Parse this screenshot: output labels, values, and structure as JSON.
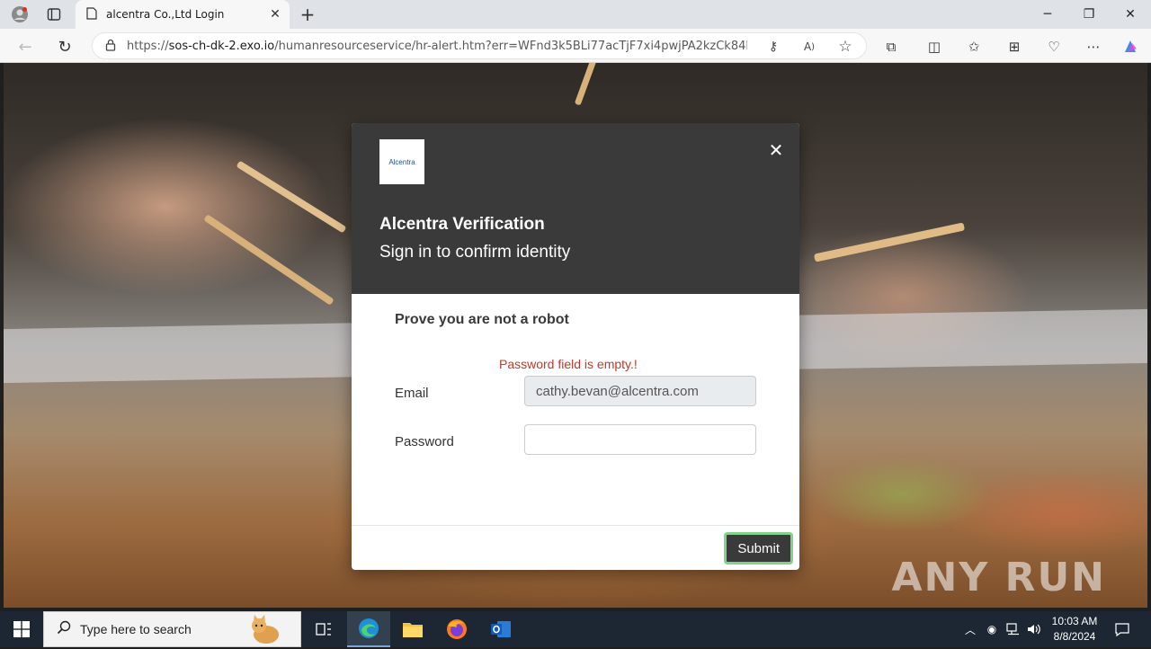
{
  "browser": {
    "tab_title": "alcentra Co.,Ltd Login",
    "url_prefix": "https://",
    "url_host": "sos-ch-dk-2.exo.io",
    "url_path": "/humanresourceservice/hr-alert.htm?err=WFnd3k5BLi77acTjF7xi4pwjPA2kzCk84lAFH..."
  },
  "modal": {
    "logo_text": "Alcentra",
    "title": "Alcentra Verification",
    "subtitle": "Sign in to confirm identity",
    "robot_heading": "Prove you are not a robot",
    "error": "Password field is empty.!",
    "email_label": "Email",
    "email_value": "cathy.bevan@alcentra.com",
    "password_label": "Password",
    "password_value": "",
    "submit_label": "Submit"
  },
  "watermark": "ANY RUN",
  "taskbar": {
    "search_placeholder": "Type here to search",
    "time": "10:03 AM",
    "date": "8/8/2024"
  }
}
